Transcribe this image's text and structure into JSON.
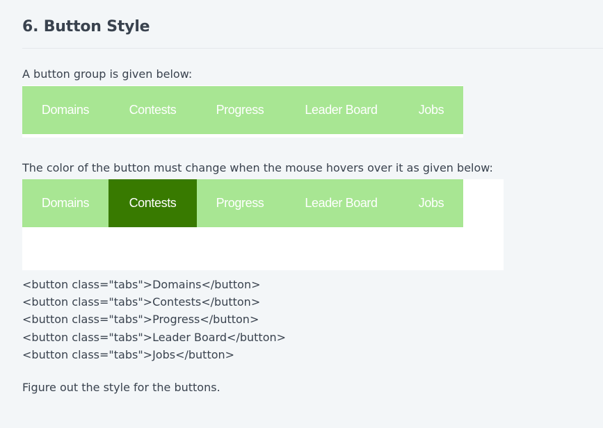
{
  "section": {
    "title": "6. Button Style"
  },
  "intro_text": "A button group is given below:",
  "hover_text": "The color of the button must change when the mouse hovers over it as given below:",
  "button_group": {
    "labels": [
      "Domains",
      "Contests",
      "Progress",
      "Leader Board",
      "Jobs"
    ],
    "hovered_index": 1
  },
  "code_lines": [
    "<button class=\"tabs\">Domains</button>",
    "<button class=\"tabs\">Contests</button>",
    "<button class=\"tabs\">Progress</button>",
    "<button class=\"tabs\">Leader Board</button>",
    "<button class=\"tabs\">Jobs</button>"
  ],
  "outro_text": "Figure out the style for the buttons.",
  "colors": {
    "page_background": "#f3f6f8",
    "text": "#39424e",
    "tab_background": "#a8e693",
    "tab_hover_background": "#387a00",
    "tab_text": "#ffffff"
  }
}
